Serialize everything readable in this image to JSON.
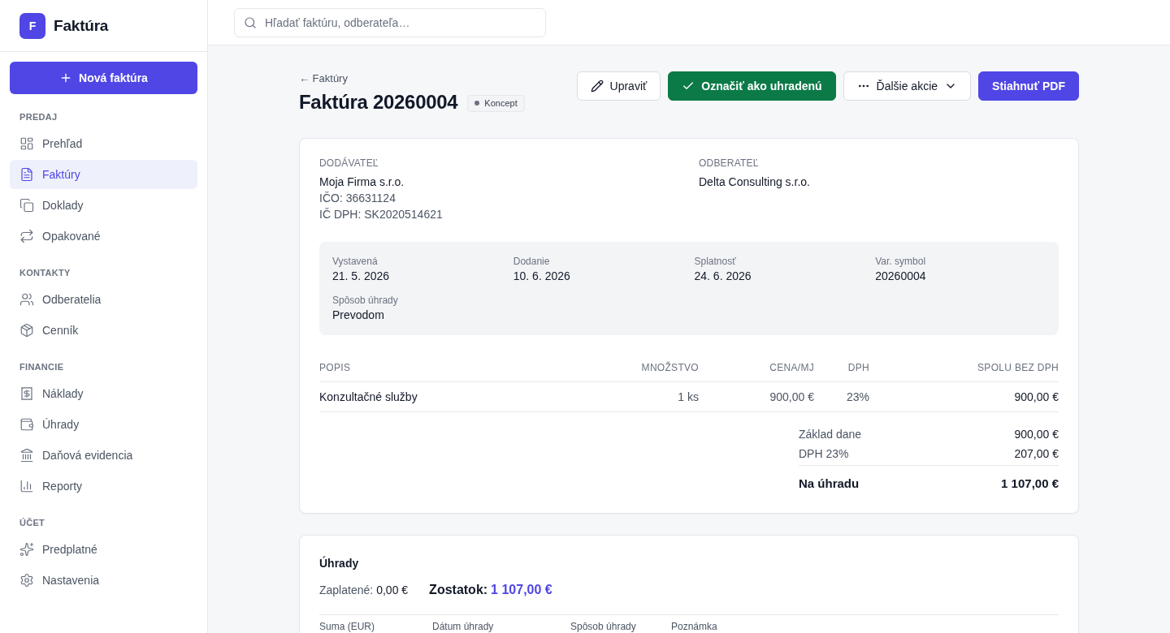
{
  "sidebar": {
    "logo": {
      "mark": "F",
      "name": "Faktúra"
    },
    "new_button": {
      "label": "Nová faktúra"
    },
    "sections": [
      {
        "title": "PREDAJ",
        "items": [
          {
            "label": "Prehľad",
            "selected": false
          },
          {
            "label": "Faktúry",
            "selected": true
          },
          {
            "label": "Doklady",
            "selected": false
          },
          {
            "label": "Opakované",
            "selected": false
          }
        ]
      },
      {
        "title": "KONTAKTY",
        "items": [
          {
            "label": "Odberatelia",
            "selected": false
          },
          {
            "label": "Cenník",
            "selected": false
          }
        ]
      },
      {
        "title": "FINANCIE",
        "items": [
          {
            "label": "Náklady",
            "selected": false
          },
          {
            "label": "Úhrady",
            "selected": false
          },
          {
            "label": "Daňová evidencia",
            "selected": false
          },
          {
            "label": "Reporty",
            "selected": false
          }
        ]
      },
      {
        "title": "ÚČET",
        "items": [
          {
            "label": "Predplatné",
            "selected": false
          },
          {
            "label": "Nastavenia",
            "selected": false
          }
        ]
      }
    ]
  },
  "topbar": {
    "search": {
      "placeholder": "Hľadať faktúru, odberateľa…"
    }
  },
  "header": {
    "back_link": "← Faktúry",
    "title": "Faktúra 20260004",
    "status": "Koncept",
    "actions": [
      {
        "kind": "edit",
        "label": "Upraviť"
      },
      {
        "kind": "success",
        "label": "Označiť ako uhradenú"
      },
      {
        "kind": "menu",
        "label": "Ďalšie akcie"
      },
      {
        "kind": "primary",
        "label": "Stiahnuť PDF"
      }
    ]
  },
  "invoice": {
    "supplier": {
      "label": "DODÁVATEĽ",
      "name": "Moja Firma s.r.o.",
      "lines": [
        "IČO: 36631124",
        "IČ DPH: SK2020514621"
      ]
    },
    "customer": {
      "label": "ODBERATEĽ",
      "name": "Delta Consulting s.r.o."
    },
    "details": [
      {
        "label": "Vystavená",
        "value": "21. 5. 2026"
      },
      {
        "label": "Dodanie",
        "value": "10. 6. 2026"
      },
      {
        "label": "Splatnosť",
        "value": "24. 6. 2026"
      },
      {
        "label": "Var. symbol",
        "value": "20260004"
      },
      {
        "label": "Spôsob úhrady",
        "value": "Prevodom"
      }
    ],
    "table": {
      "columns": [
        "POPIS",
        "MNOŽSTVO",
        "CENA/MJ",
        "DPH",
        "SPOLU BEZ DPH"
      ],
      "rows": [
        [
          "Konzultačné služby",
          "1 ks",
          "900,00 €",
          "23%",
          "900,00 €"
        ]
      ]
    },
    "totals": [
      {
        "kind": "line",
        "label": "Základ dane",
        "value": "900,00 €"
      },
      {
        "kind": "line",
        "label": "DPH 23%",
        "value": "207,00 €"
      },
      {
        "kind": "grand",
        "label": "Na úhradu",
        "value": "1 107,00 €"
      }
    ]
  },
  "payments": {
    "title": "Úhrady",
    "paid": {
      "label": "Zaplatené:",
      "value": "0,00 €"
    },
    "balance": {
      "label": "Zostatok:",
      "value": "1 107,00 €"
    },
    "columns": [
      "Suma (EUR)",
      "Dátum úhrady",
      "Spôsob úhrady",
      "Poznámka"
    ]
  }
}
